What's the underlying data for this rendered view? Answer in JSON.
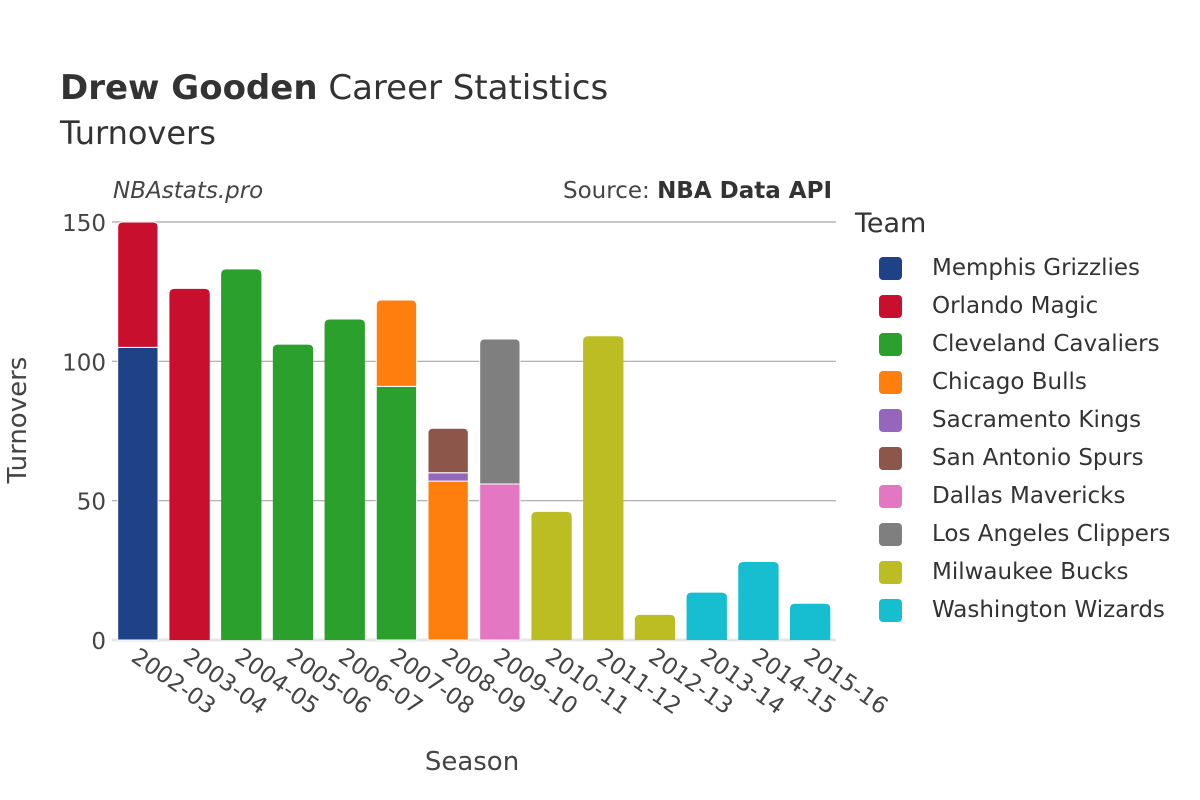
{
  "header": {
    "player": "Drew Gooden",
    "title_rest": "Career Statistics",
    "subtitle": "Turnovers",
    "watermark": "NBAstats.pro",
    "source_prefix": "Source: ",
    "source_name": "NBA Data API"
  },
  "chart_data": {
    "type": "bar",
    "stacked": true,
    "title": "Drew Gooden Career Statistics",
    "subtitle": "Turnovers",
    "xlabel": "Season",
    "ylabel": "Turnovers",
    "ylim": [
      0,
      150
    ],
    "yticks": [
      0,
      50,
      100,
      150
    ],
    "grid": true,
    "legend_title": "Team",
    "legend_position": "right",
    "categories": [
      "2002-03",
      "2003-04",
      "2004-05",
      "2005-06",
      "2006-07",
      "2007-08",
      "2008-09",
      "2009-10",
      "2010-11",
      "2011-12",
      "2012-13",
      "2013-14",
      "2014-15",
      "2015-16"
    ],
    "series": [
      {
        "name": "Memphis Grizzlies",
        "color": "#1f4287",
        "values": [
          105,
          0,
          0,
          0,
          0,
          0,
          0,
          0,
          0,
          0,
          0,
          0,
          0,
          0
        ]
      },
      {
        "name": "Orlando Magic",
        "color": "#c8102e",
        "values": [
          45,
          126,
          0,
          0,
          0,
          0,
          0,
          0,
          0,
          0,
          0,
          0,
          0,
          0
        ]
      },
      {
        "name": "Cleveland Cavaliers",
        "color": "#2ca02c",
        "values": [
          0,
          0,
          133,
          106,
          115,
          91,
          0,
          0,
          0,
          0,
          0,
          0,
          0,
          0
        ]
      },
      {
        "name": "Chicago Bulls",
        "color": "#ff7f0e",
        "values": [
          0,
          0,
          0,
          0,
          0,
          31,
          57,
          0,
          0,
          0,
          0,
          0,
          0,
          0
        ]
      },
      {
        "name": "Sacramento Kings",
        "color": "#9467bd",
        "values": [
          0,
          0,
          0,
          0,
          0,
          0,
          3,
          0,
          0,
          0,
          0,
          0,
          0,
          0
        ]
      },
      {
        "name": "San Antonio Spurs",
        "color": "#8c564b",
        "values": [
          0,
          0,
          0,
          0,
          0,
          0,
          16,
          0,
          0,
          0,
          0,
          0,
          0,
          0
        ]
      },
      {
        "name": "Dallas Mavericks",
        "color": "#e377c2",
        "values": [
          0,
          0,
          0,
          0,
          0,
          0,
          0,
          56,
          0,
          0,
          0,
          0,
          0,
          0
        ]
      },
      {
        "name": "Los Angeles Clippers",
        "color": "#7f7f7f",
        "values": [
          0,
          0,
          0,
          0,
          0,
          0,
          0,
          52,
          0,
          0,
          0,
          0,
          0,
          0
        ]
      },
      {
        "name": "Milwaukee Bucks",
        "color": "#bcbd22",
        "values": [
          0,
          0,
          0,
          0,
          0,
          0,
          0,
          0,
          46,
          109,
          9,
          0,
          0,
          0
        ]
      },
      {
        "name": "Washington Wizards",
        "color": "#17becf",
        "values": [
          0,
          0,
          0,
          0,
          0,
          0,
          0,
          0,
          0,
          0,
          0,
          17,
          28,
          13
        ]
      }
    ]
  }
}
